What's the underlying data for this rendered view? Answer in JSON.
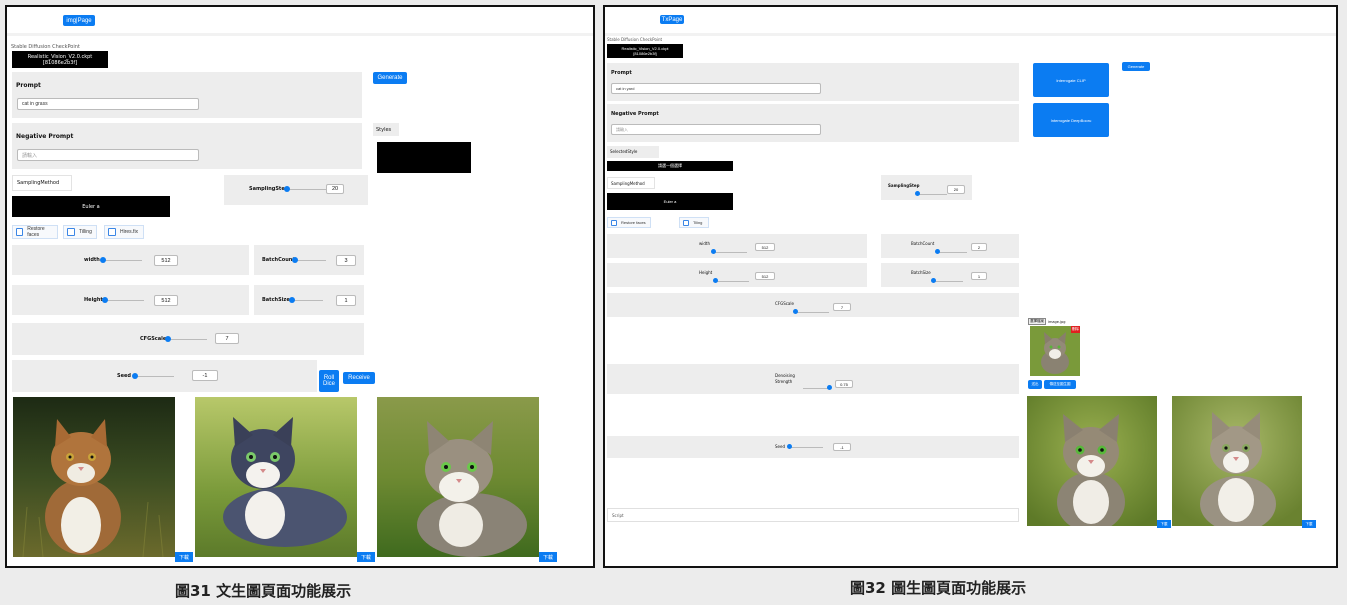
{
  "left": {
    "nav_button": "img|Page",
    "checkpoint_label": "Stable Diffusion CheckPoint",
    "checkpoint_line1": "Realistic_Vision_V2.0.ckpt",
    "checkpoint_line2": "[81086e2b3f]",
    "prompt_title": "Prompt",
    "prompt_value": "cat in grass",
    "generate_button": "Generate",
    "neg_title": "Negative Prompt",
    "neg_placeholder": "請輸入",
    "styles_label": "Styles",
    "sampling_method_label": "SamplingMethod",
    "sampling_method_value": "Euler a",
    "sampling_step_label": "SamplingStep",
    "sampling_step_value": "20",
    "checkboxes": [
      "Restore faces",
      "Tilling",
      "Hires.fix"
    ],
    "width_label": "width",
    "width_value": "512",
    "batch_count_label": "BatchCount",
    "batch_count_value": "3",
    "height_label": "Height",
    "height_value": "512",
    "batch_size_label": "BatchSize",
    "batch_size_value": "1",
    "cfg_label": "CFGScale",
    "cfg_value": "7",
    "seed_label": "Seed",
    "seed_value": "-1",
    "roll_line1": "Roll",
    "roll_line2": "Dice",
    "receive_button": "Receive",
    "download_label": "下載",
    "caption": "圖31 文生圖頁面功能展示"
  },
  "right": {
    "nav_button": "TxPage",
    "checkpoint_label": "Stable Diffusion CheckPoint",
    "checkpoint_line1": "Realistic_Vision_V2.0.ckpt",
    "checkpoint_line2": "[81086e2b3f]",
    "prompt_title": "Prompt",
    "prompt_value": "cat in yard",
    "neg_title": "Negative Prompt",
    "neg_placeholder": "請輸入",
    "interrogate_clip": "Interrogate CLIP",
    "interrogate_deepbooru": "Interrogate DeepBooru",
    "generate_button": "Generate",
    "styles_label": "SelectedStyle",
    "styles_black": "請選一個選擇",
    "sampling_method_label": "SamplingMethod",
    "sampling_method_value": "Euler a",
    "sampling_step_label": "SamplingStep",
    "sampling_step_value": "20",
    "checkboxes": [
      "Restore faces",
      "Tiling"
    ],
    "width_label": "width",
    "width_value": "512",
    "batch_count_label": "BatchCount",
    "batch_count_value": "2",
    "height_label": "Height",
    "height_value": "512",
    "batch_size_label": "BatchSize",
    "batch_size_value": "1",
    "cfg_label": "CFGScale",
    "cfg_value": "7",
    "denoise_line1": "Denoising",
    "denoise_line2": "Strength",
    "denoise_value": "0.75",
    "seed_label": "Seed",
    "seed_value": "-1",
    "script_label": "Script",
    "upload_button": "選擇檔案",
    "upload_filename": "image.jpg",
    "delete_badge": "刪除",
    "send_button": "送出",
    "send_to_button": "傳送至圖生圖",
    "download_label": "下載",
    "caption": "圖32 圖生圖頁面功能展示"
  },
  "colors": {
    "accent": "#0b7cf2",
    "panel": "#ededed"
  }
}
